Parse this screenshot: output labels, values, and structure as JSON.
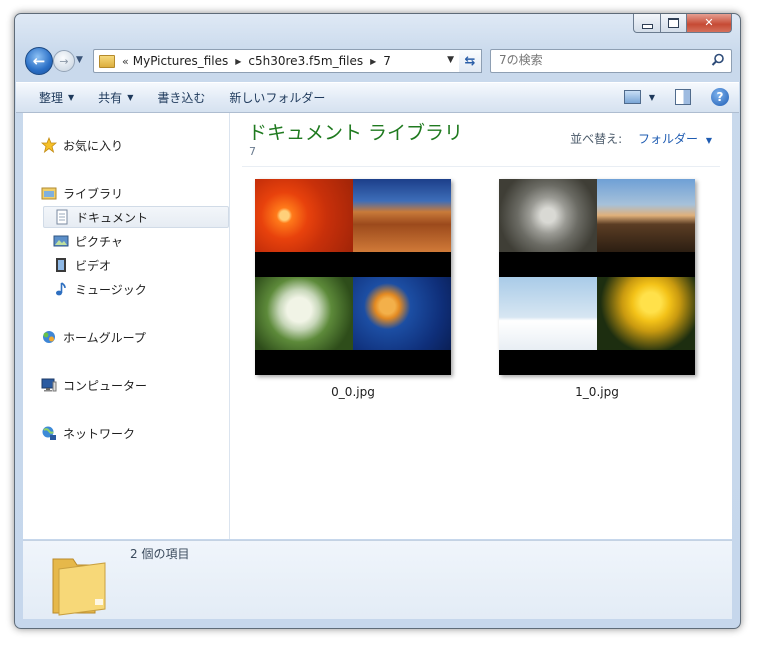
{
  "address": {
    "chevron": "«",
    "crumbs": [
      "MyPictures_files",
      "c5h30re3.f5m_files",
      "7"
    ]
  },
  "search": {
    "placeholder": "7の検索"
  },
  "toolbar": {
    "organize": "整理",
    "share": "共有",
    "burn": "書き込む",
    "new_folder": "新しいフォルダー"
  },
  "nav": {
    "favorites": "お気に入り",
    "libraries": "ライブラリ",
    "documents": "ドキュメント",
    "pictures": "ピクチャ",
    "videos": "ビデオ",
    "music": "ミュージック",
    "homegroup": "ホームグループ",
    "computer": "コンピューター",
    "network": "ネットワーク"
  },
  "content": {
    "title": "ドキュメント ライブラリ",
    "subtitle": "7",
    "arrange_label": "並べ替え:",
    "arrange_value": "フォルダー"
  },
  "files": [
    {
      "name": "0_0.jpg",
      "tiles": [
        "flower",
        "desert",
        "hydrangea",
        "jellyfish"
      ]
    },
    {
      "name": "1_0.jpg",
      "tiles": [
        "koala",
        "lighthouse",
        "penguins",
        "tulips"
      ]
    }
  ],
  "details": {
    "item_count": "2 個の項目"
  },
  "colors": {
    "library_title": "#1f7a1f",
    "link_blue": "#1f5cb2"
  }
}
